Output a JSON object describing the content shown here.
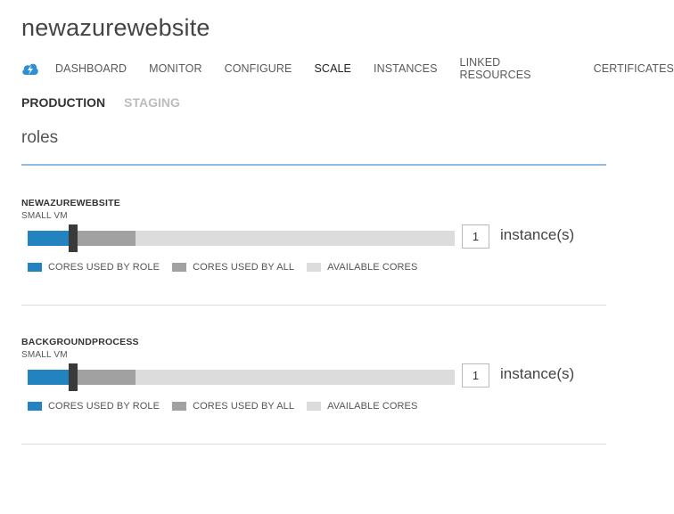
{
  "page": {
    "title": "newazurewebsite"
  },
  "nav": {
    "items": [
      "DASHBOARD",
      "MONITOR",
      "CONFIGURE",
      "SCALE",
      "INSTANCES",
      "LINKED RESOURCES",
      "CERTIFICATES"
    ],
    "active": "SCALE"
  },
  "subtabs": {
    "production": "PRODUCTION",
    "staging": "STAGING",
    "active": "PRODUCTION"
  },
  "section": {
    "title": "roles"
  },
  "legend": {
    "used_by_role": "CORES USED BY ROLE",
    "used_by_all": "CORES USED BY ALL",
    "available": "AVAILABLE CORES"
  },
  "colors": {
    "used_by_role": "#2383c0",
    "used_by_all": "#a1a1a1",
    "available": "#dcdcdc",
    "accent_rule": "#8ebde3"
  },
  "roles": [
    {
      "name": "NEWAZUREWEBSITE",
      "size": "SMALL VM",
      "instances": "1",
      "instance_unit": "instance(s)",
      "fraction_used_by_role": 0.108,
      "fraction_used_by_all": 0.253
    },
    {
      "name": "BACKGROUNDPROCESS",
      "size": "SMALL VM",
      "instances": "1",
      "instance_unit": "instance(s)",
      "fraction_used_by_role": 0.108,
      "fraction_used_by_all": 0.253
    }
  ]
}
